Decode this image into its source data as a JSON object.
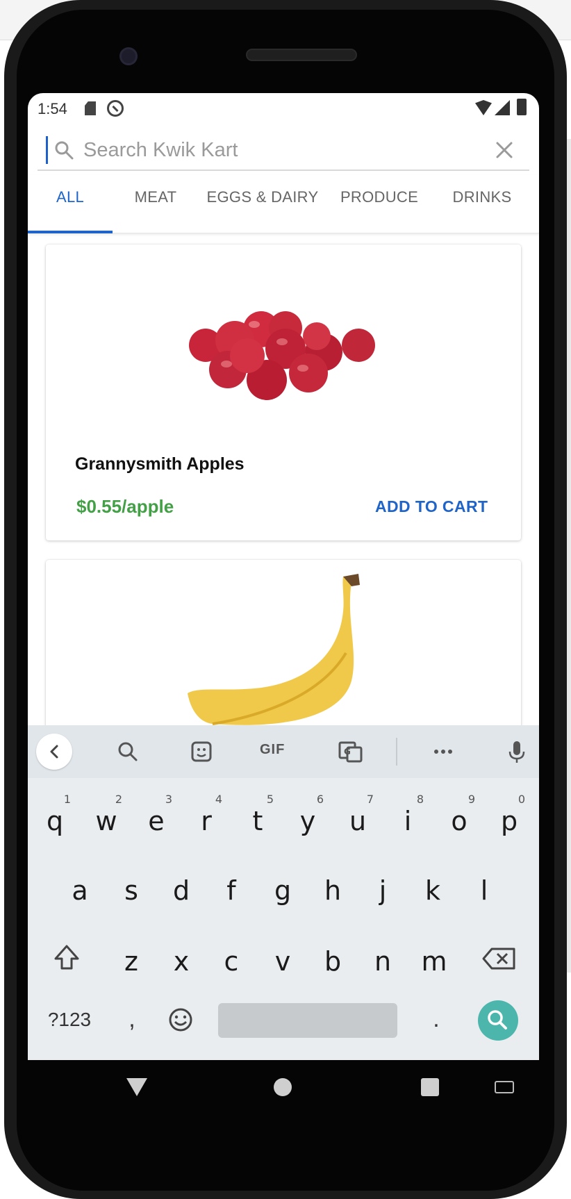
{
  "status_bar": {
    "time": "1:54"
  },
  "search": {
    "placeholder": "Search Kwik Kart"
  },
  "tabs": [
    {
      "label": "ALL",
      "active": true
    },
    {
      "label": "MEAT"
    },
    {
      "label": "EGGS & DAIRY"
    },
    {
      "label": "PRODUCE"
    },
    {
      "label": "DRINKS"
    }
  ],
  "products": [
    {
      "name": "Grannysmith Apples",
      "price": "$0.55/apple",
      "action": "ADD TO CART",
      "image": "apples"
    },
    {
      "name": "",
      "price": "",
      "action": "",
      "image": "banana"
    }
  ],
  "keyboard": {
    "toolbar": {
      "gif": "GIF"
    },
    "row1": [
      {
        "key": "q",
        "hint": "1"
      },
      {
        "key": "w",
        "hint": "2"
      },
      {
        "key": "e",
        "hint": "3"
      },
      {
        "key": "r",
        "hint": "4"
      },
      {
        "key": "t",
        "hint": "5"
      },
      {
        "key": "y",
        "hint": "6"
      },
      {
        "key": "u",
        "hint": "7"
      },
      {
        "key": "i",
        "hint": "8"
      },
      {
        "key": "o",
        "hint": "9"
      },
      {
        "key": "p",
        "hint": "0"
      }
    ],
    "row2": [
      "a",
      "s",
      "d",
      "f",
      "g",
      "h",
      "j",
      "k",
      "l"
    ],
    "row3": [
      "z",
      "x",
      "c",
      "v",
      "b",
      "n",
      "m"
    ],
    "symbols": "?123",
    "comma": ",",
    "period": "."
  },
  "colors": {
    "accent": "#1f64c8",
    "price": "#43a047",
    "keyboard_bg": "#e9edf0",
    "search_fab": "#4db6ac"
  }
}
